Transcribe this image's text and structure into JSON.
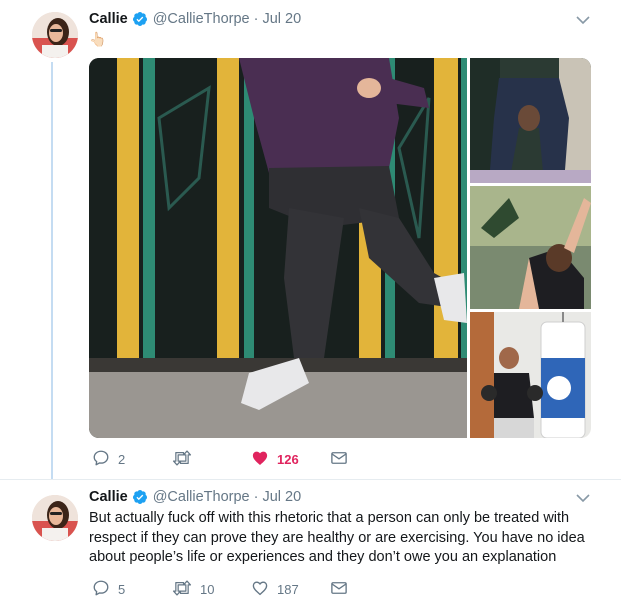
{
  "colors": {
    "verified_blue": "#1da1f2",
    "like_red": "#e0245e",
    "muted": "#657786",
    "thread_line": "#c4dcf2"
  },
  "tweets": [
    {
      "display_name": "Callie",
      "handle": "@CallieThorpe",
      "date": "Jul 20",
      "emoji": "👆🏻",
      "media": {
        "images": [
          "running woman in purple top and leggings",
          "stretching woman",
          "woman reaching up",
          "woman with boxing bag"
        ]
      },
      "replies": "2",
      "retweets": "",
      "likes": "126",
      "liked": true
    },
    {
      "display_name": "Callie",
      "handle": "@CallieThorpe",
      "date": "Jul 20",
      "text": "But actually fuck off with this rhetoric that a person can only be treated with respect if they can prove they are healthy or are exercising. You have no idea about people’s life or experiences and they don’t owe you an explanation",
      "replies": "5",
      "retweets": "10",
      "likes": "187",
      "liked": false
    }
  ]
}
